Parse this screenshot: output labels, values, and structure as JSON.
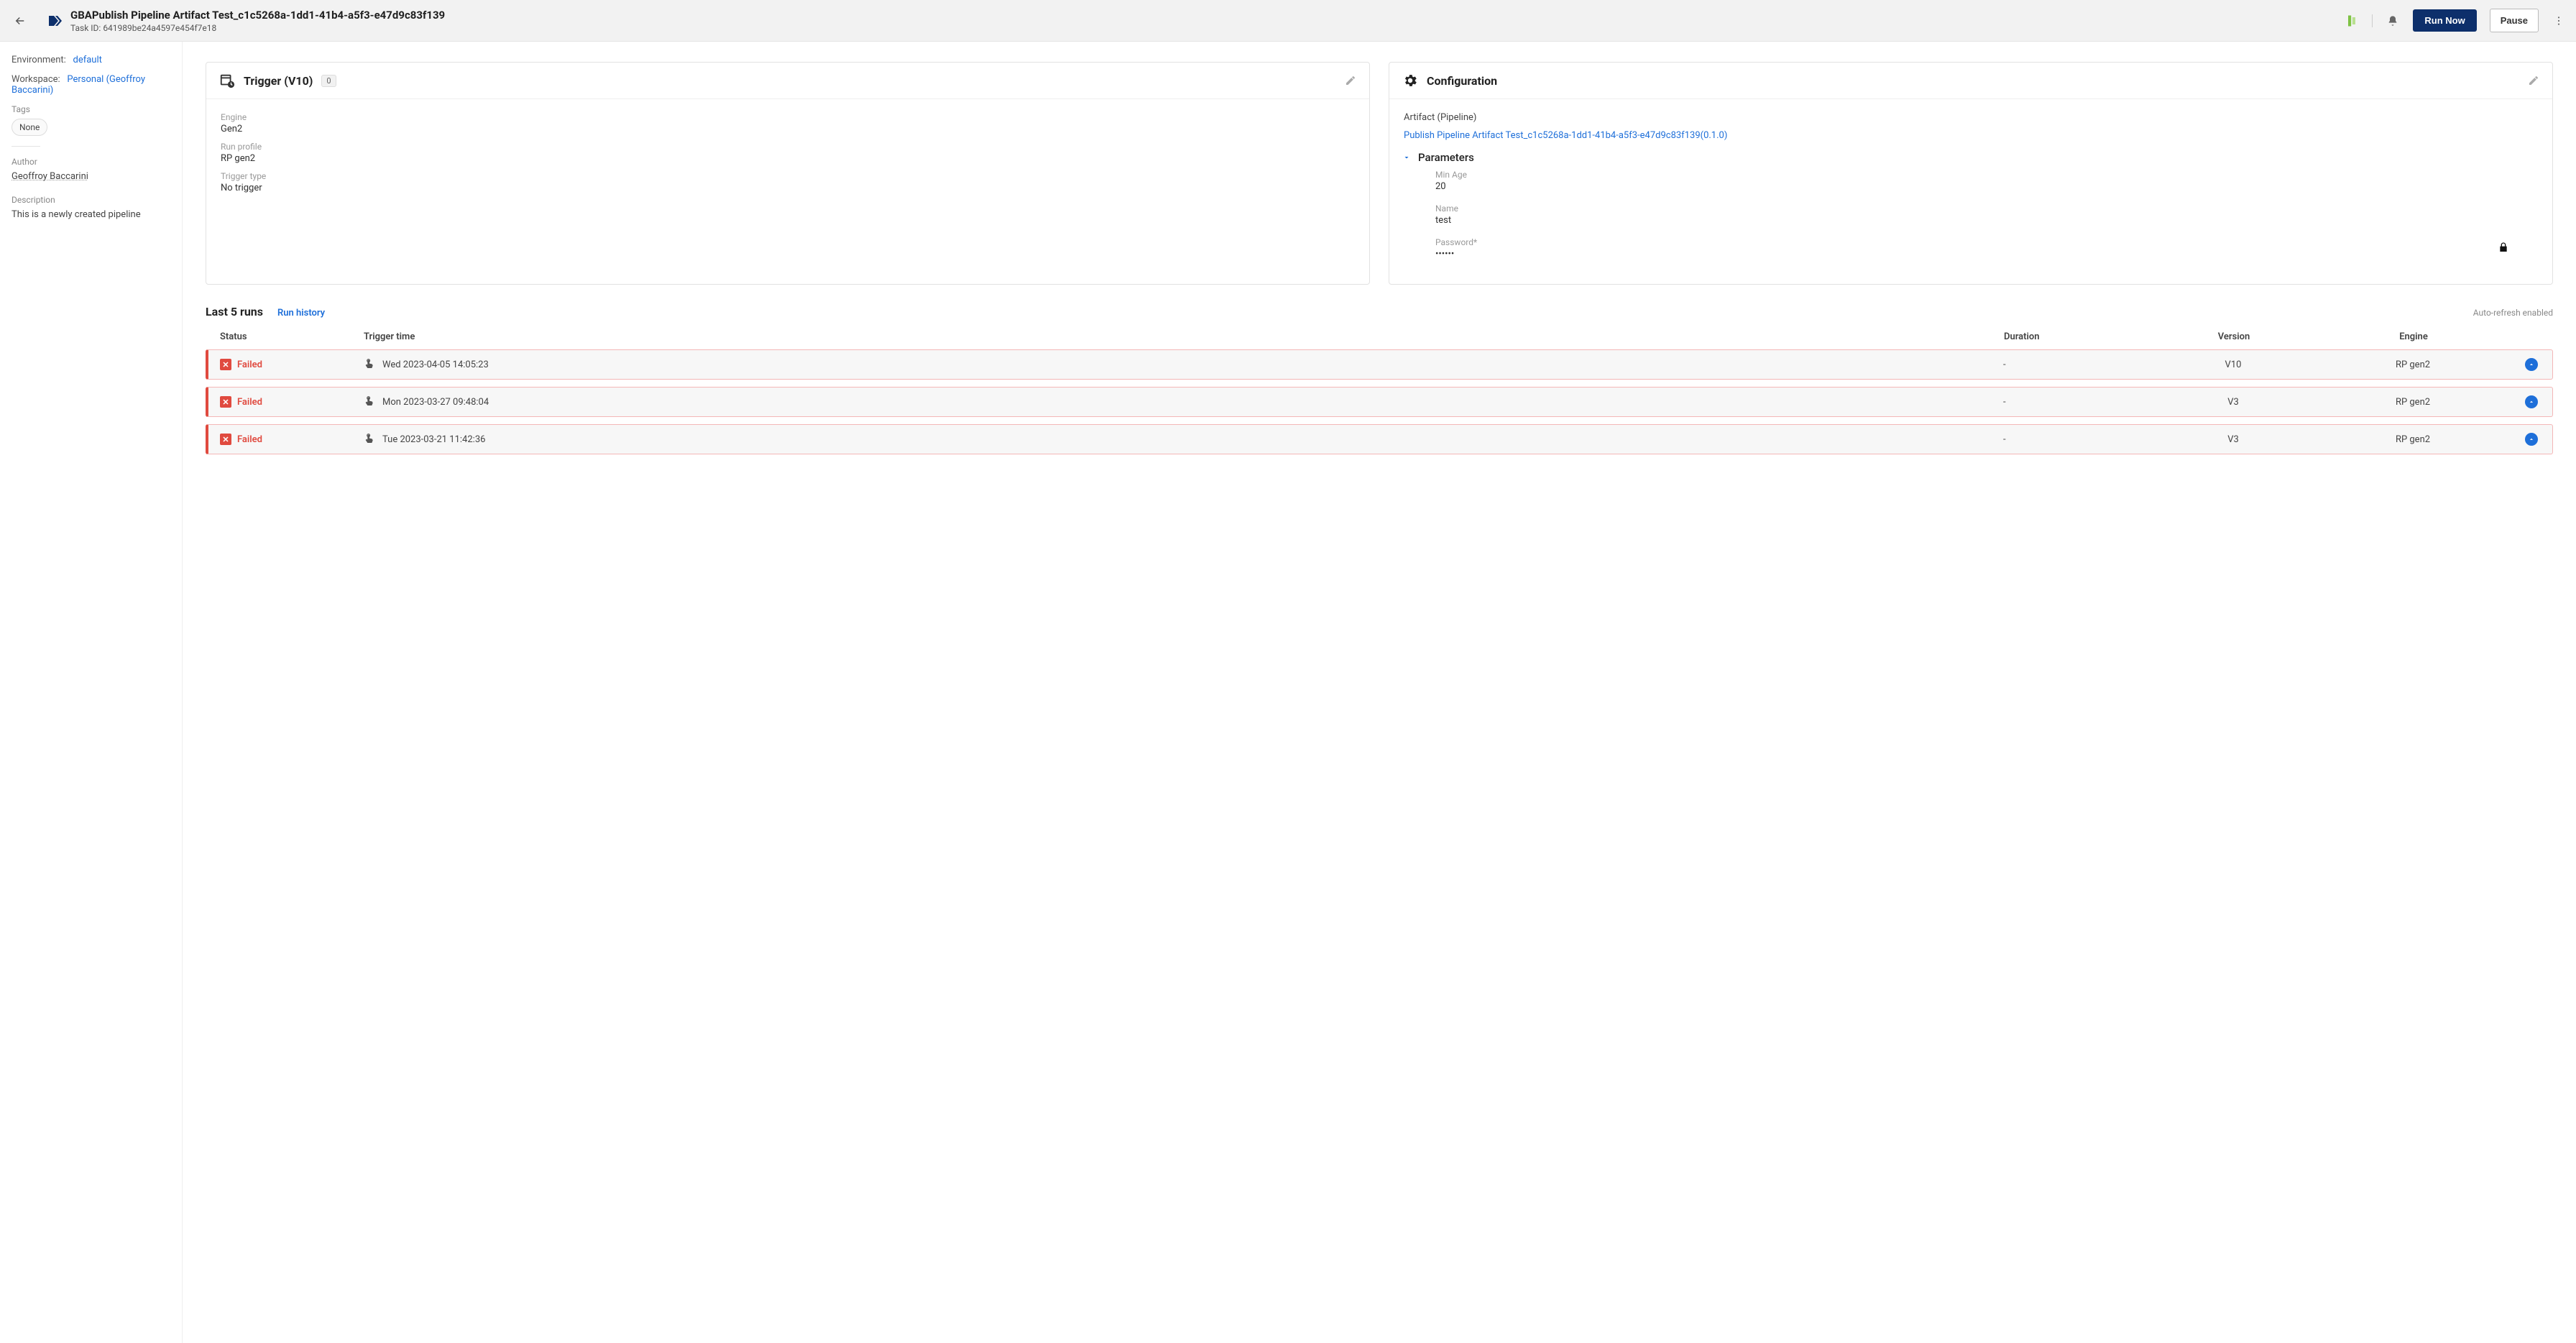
{
  "header": {
    "title": "GBAPublish Pipeline Artifact Test_c1c5268a-1dd1-41b4-a5f3-e47d9c83f139",
    "task_id_label": "Task ID:",
    "task_id_value": "641989be24a4597e454f7e18",
    "run_now": "Run Now",
    "pause": "Pause"
  },
  "sidebar": {
    "env_label": "Environment:",
    "env_value": "default",
    "ws_label": "Workspace:",
    "ws_value": "Personal (Geoffroy Baccarini)",
    "tags_label": "Tags",
    "tags_none": "None",
    "author_label": "Author",
    "author_value": "Geoffroy Baccarini",
    "desc_label": "Description",
    "desc_value": "This is a newly created pipeline"
  },
  "trigger": {
    "title": "Trigger (V10)",
    "badge": "0",
    "engine_label": "Engine",
    "engine_value": "Gen2",
    "profile_label": "Run profile",
    "profile_value": "RP gen2",
    "type_label": "Trigger type",
    "type_value": "No trigger"
  },
  "config": {
    "title": "Configuration",
    "artifact_label": "Artifact (Pipeline)",
    "artifact_link": "Publish Pipeline Artifact Test_c1c5268a-1dd1-41b4-a5f3-e47d9c83f139(0.1.0)",
    "params_label": "Parameters",
    "p_minage_label": "Min Age",
    "p_minage_value": "20",
    "p_name_label": "Name",
    "p_name_value": "test",
    "p_pass_label": "Password*",
    "p_pass_value": "••••••"
  },
  "runs": {
    "title": "Last 5 runs",
    "history": "Run history",
    "auto": "Auto-refresh enabled",
    "cols": {
      "status": "Status",
      "trigger": "Trigger time",
      "duration": "Duration",
      "version": "Version",
      "engine": "Engine"
    },
    "rows": [
      {
        "status": "Failed",
        "trigger_time": "Wed 2023-04-05 14:05:23",
        "duration": "-",
        "version": "V10",
        "engine": "RP gen2"
      },
      {
        "status": "Failed",
        "trigger_time": "Mon 2023-03-27 09:48:04",
        "duration": "-",
        "version": "V3",
        "engine": "RP gen2"
      },
      {
        "status": "Failed",
        "trigger_time": "Tue 2023-03-21 11:42:36",
        "duration": "-",
        "version": "V3",
        "engine": "RP gen2"
      }
    ]
  }
}
